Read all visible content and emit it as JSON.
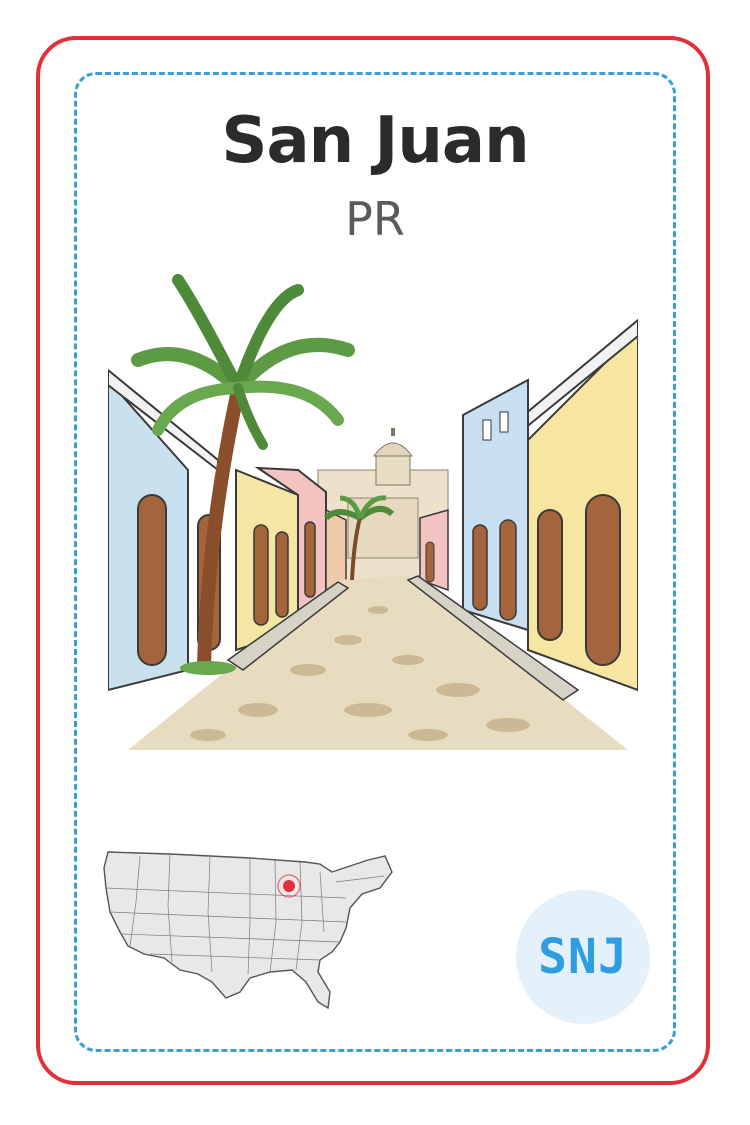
{
  "card": {
    "city": "San Juan",
    "region": "PR",
    "code": "SNJ"
  },
  "illustration": {
    "subject": "old-san-juan-street-scene"
  },
  "map": {
    "marker_color": "#e0303a"
  },
  "colors": {
    "border": "#e0303a",
    "dashed_border": "#3a9fd8",
    "code_text": "#2f9ee0",
    "code_badge_bg": "#e4f1fb"
  }
}
